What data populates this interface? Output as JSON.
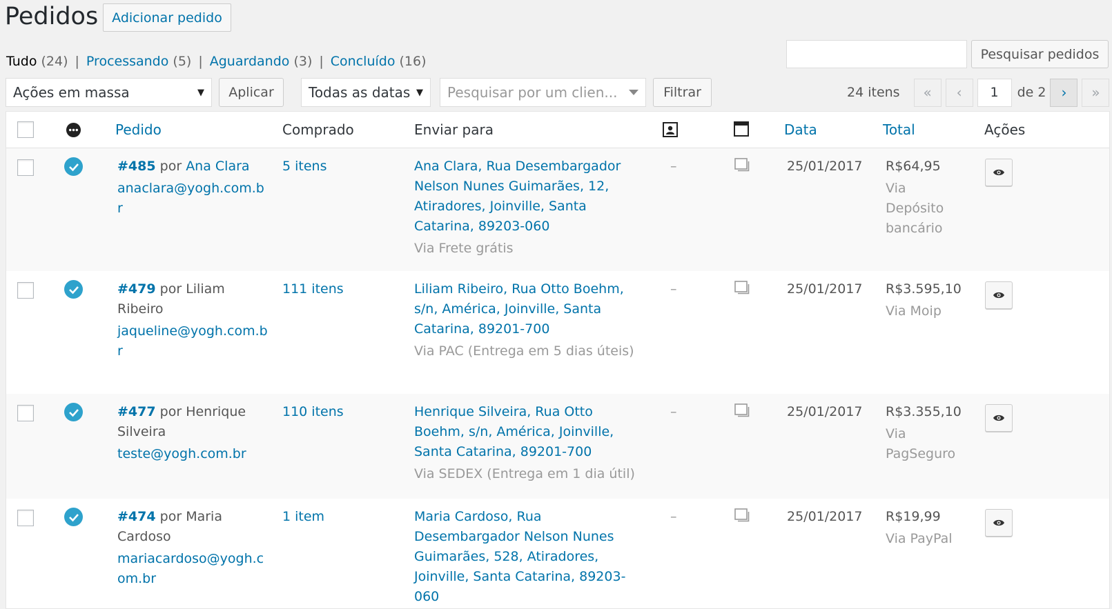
{
  "header": {
    "title": "Pedidos",
    "add_label": "Adicionar pedido"
  },
  "status_filters": [
    {
      "label": "Tudo",
      "count": "(24)"
    },
    {
      "label": "Processando",
      "count": "(5)"
    },
    {
      "label": "Aguardando",
      "count": "(3)"
    },
    {
      "label": "Concluído",
      "count": "(16)"
    }
  ],
  "search": {
    "value": "",
    "button_label": "Pesquisar pedidos"
  },
  "tablenav": {
    "bulk_actions": "Ações em massa",
    "apply_label": "Aplicar",
    "dates": "Todas as datas",
    "customer_placeholder": "Pesquisar por um clien...",
    "filter_label": "Filtrar",
    "item_count": "24 itens",
    "first": "«",
    "prev": "‹",
    "current_page": "1",
    "of_pages": "de 2",
    "next": "›",
    "last": "»"
  },
  "columns": {
    "pedido": "Pedido",
    "comprado": "Comprado",
    "enviar_para": "Enviar para",
    "data": "Data",
    "total": "Total",
    "acoes": "Ações"
  },
  "orders": [
    {
      "number": "#485",
      "by": "por",
      "customer_link": "Ana Clara",
      "customer_text": "",
      "email_lines": [
        "anaclara@yogh.com.br"
      ],
      "items": "5 itens",
      "ship_lines": [
        "Ana Clara, Rua Desembargador",
        "Nelson Nunes Guimarães, 12,",
        "Atiradores, Joinville, Santa",
        "Catarina, 89203-060"
      ],
      "ship_method": "Via Frete grátis",
      "dash": "–",
      "date": "25/01/2017",
      "total": "R$64,95",
      "via_lines": [
        "Via",
        "Depósito",
        "bancário"
      ]
    },
    {
      "number": "#479",
      "by": "por",
      "customer_link": "",
      "customer_text": "Liliam",
      "customer_text_2": "Ribeiro",
      "email_lines": [
        "jaqueline@yogh.com.b",
        "r"
      ],
      "items": "111 itens",
      "ship_lines": [
        "Liliam Ribeiro, Rua Otto Boehm,",
        "s/n, América, Joinville, Santa",
        "Catarina, 89201-700"
      ],
      "ship_method": "Via PAC (Entrega em 5 dias úteis)",
      "dash": "–",
      "date": "25/01/2017",
      "total": "R$3.595,10",
      "via_lines": [
        "Via Moip"
      ]
    },
    {
      "number": "#477",
      "by": "por",
      "customer_link": "",
      "customer_text": "Henrique",
      "customer_text_2": "Silveira",
      "email_lines": [
        "teste@yogh.com.br"
      ],
      "items": "110 itens",
      "ship_lines": [
        "Henrique Silveira, Rua Otto",
        "Boehm, s/n, América, Joinville,",
        "Santa Catarina, 89201-700"
      ],
      "ship_method": "Via SEDEX (Entrega em 1 dia útil)",
      "dash": "–",
      "date": "25/01/2017",
      "total": "R$3.355,10",
      "via_lines": [
        "Via",
        "PagSeguro"
      ]
    },
    {
      "number": "#474",
      "by": "por",
      "customer_link": "",
      "customer_text": "Maria",
      "customer_text_2": "Cardoso",
      "email_lines": [
        "mariacardoso@yogh.c",
        "om.br"
      ],
      "items": "1 item",
      "ship_lines": [
        "Maria Cardoso, Rua",
        "Desembargador Nelson Nunes",
        "Guimarães, 528, Atiradores,",
        "Joinville, Santa Catarina, 89203-",
        "060"
      ],
      "ship_method": "",
      "dash": "–",
      "date": "25/01/2017",
      "total": "R$19,99",
      "via_lines": [
        "Via PayPal"
      ]
    }
  ],
  "colors": {
    "link": "#0073aa",
    "status_completed": "#2ea2cc"
  }
}
